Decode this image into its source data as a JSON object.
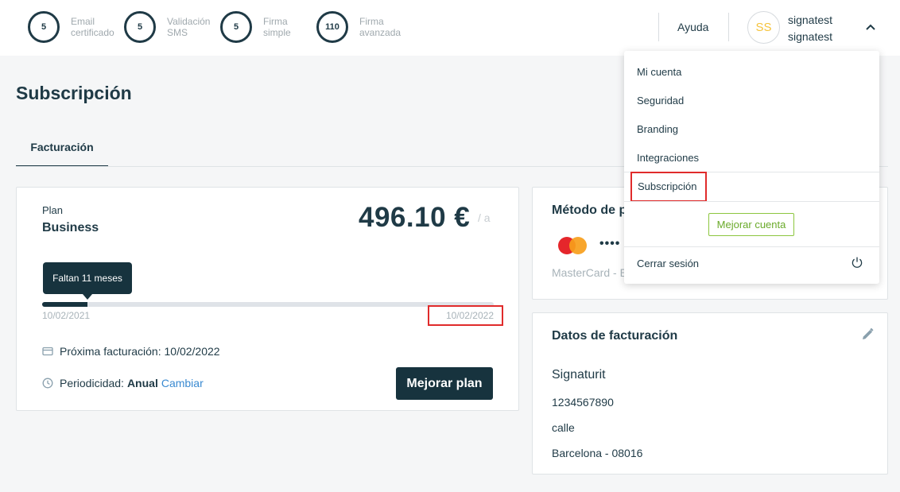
{
  "header": {
    "credits": [
      {
        "count": "5",
        "label_line1": "Email",
        "label_line2": "certificado"
      },
      {
        "count": "5",
        "label_line1": "Validación",
        "label_line2": "SMS"
      },
      {
        "count": "5",
        "label_line1": "Firma",
        "label_line2": "simple"
      },
      {
        "count": "110",
        "label_line1": "Firma",
        "label_line2": "avanzada"
      }
    ],
    "help_label": "Ayuda",
    "avatar_initials": "SS",
    "user_line1": "signatest",
    "user_line2": "signatest"
  },
  "page": {
    "title": "Subscripción",
    "tab_label": "Facturación"
  },
  "plan": {
    "label": "Plan",
    "name": "Business",
    "price": "496.10 €",
    "period_suffix": "/ a",
    "tooltip": "Faltan 11 meses",
    "progress_fraction": 0.1,
    "start_date": "10/02/2021",
    "end_date": "10/02/2022",
    "next_billing": "Próxima facturación: 10/02/2022",
    "periodicity_label": "Periodicidad:",
    "periodicity_value": "Anual",
    "change_link": "Cambiar",
    "upgrade_button": "Mejorar plan"
  },
  "payment": {
    "title": "Método de pa",
    "card_dots": "••••",
    "card_name": "MasterCard - E"
  },
  "billing": {
    "title": "Datos de facturación",
    "company": "Signaturit",
    "tax_id": "1234567890",
    "street": "calle",
    "city": "Barcelona - 08016"
  },
  "menu": {
    "items": [
      "Mi cuenta",
      "Seguridad",
      "Branding",
      "Integraciones"
    ],
    "selected": "Subscripción",
    "upgrade_button": "Mejorar cuenta",
    "logout": "Cerrar sesión"
  },
  "colors": {
    "primary": "#17333e",
    "link": "#3a8ad1",
    "highlight": "#e02b2b",
    "upgrade": "#8cc63f",
    "avatar_text": "#f5c33b"
  },
  "icons": {
    "chevron": "chevron-up-icon",
    "calendar": "credit-card-icon",
    "clock": "clock-icon",
    "edit": "pencil-icon",
    "logout": "power-icon"
  }
}
